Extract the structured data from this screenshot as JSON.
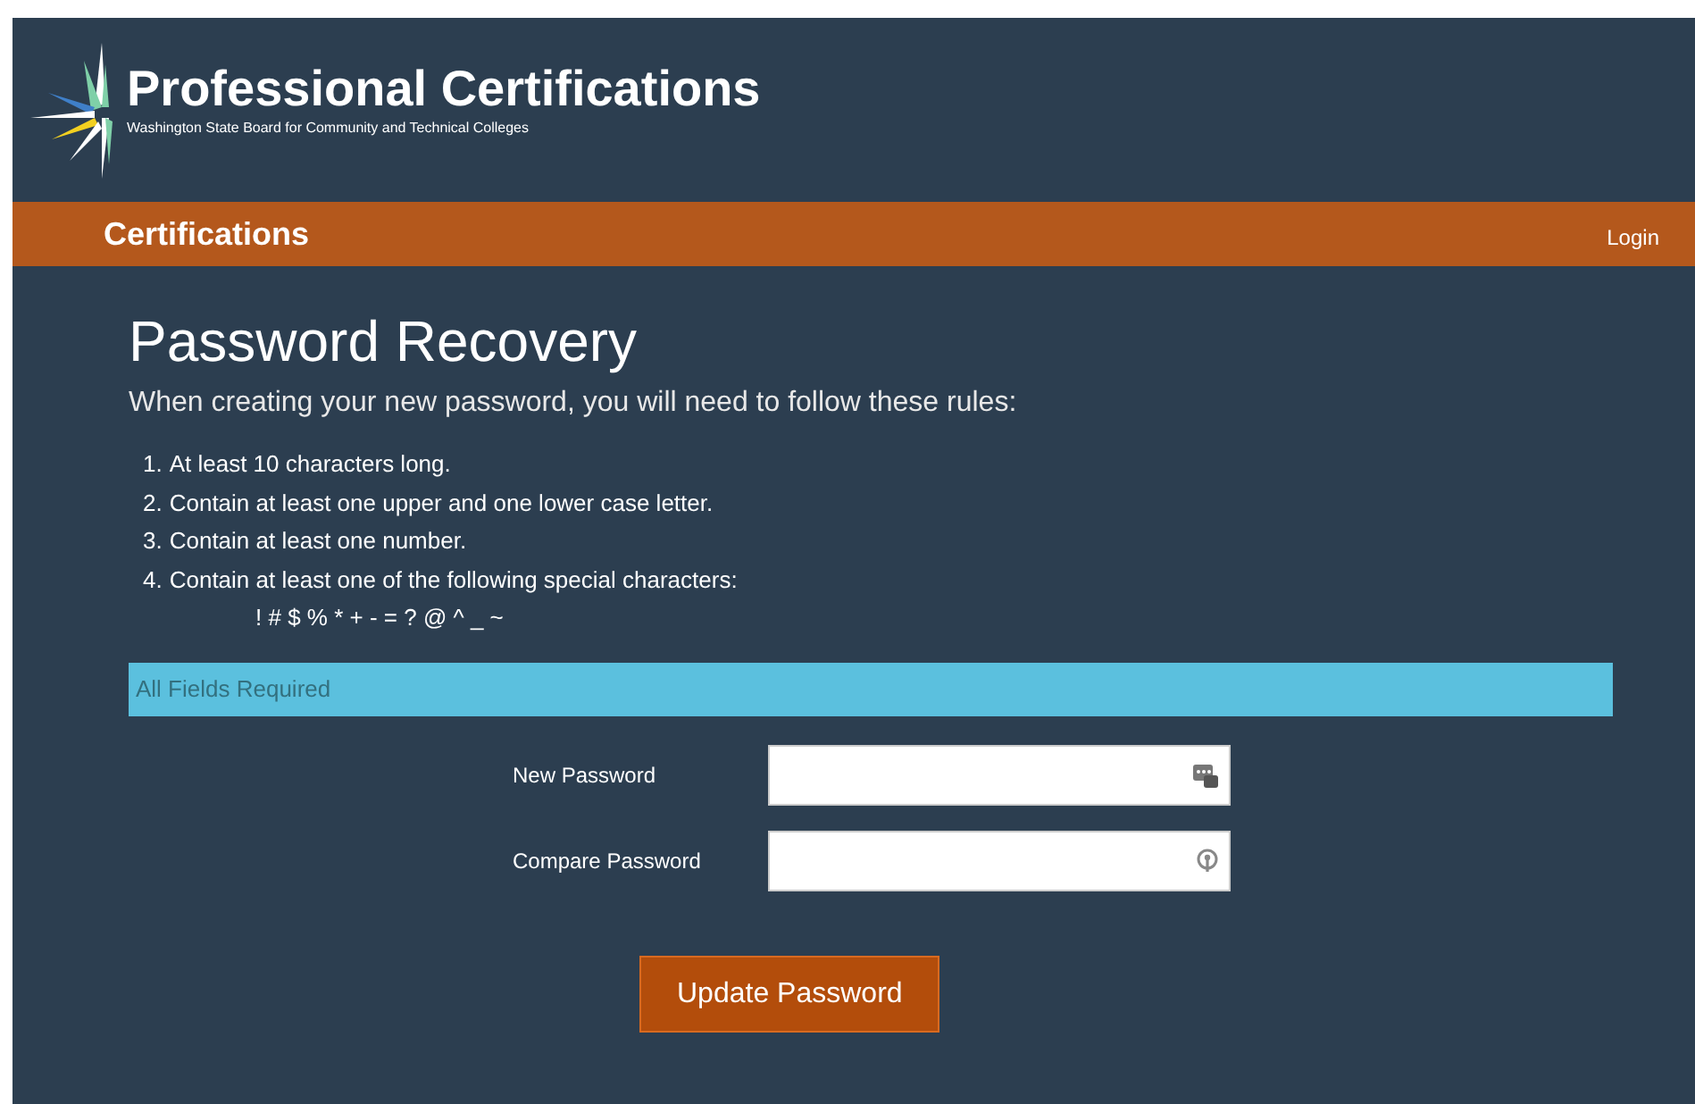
{
  "header": {
    "title": "Professional Certifications",
    "subtitle": "Washington State Board for Community and Technical Colleges"
  },
  "nav": {
    "brand": "Certifications",
    "links": [
      "Login"
    ]
  },
  "page": {
    "heading": "Password Recovery",
    "intro": "When creating your new password, you will need to follow these rules:",
    "rules": [
      {
        "number": "1.",
        "text": "At least 10 characters long."
      },
      {
        "number": "2.",
        "text": "Contain at least one upper and one lower case letter."
      },
      {
        "number": "3.",
        "text": "Contain at least one number."
      },
      {
        "number": "4.",
        "text": "Contain at least one of the following special characters:"
      }
    ],
    "special_characters": "! # $ % * + - = ? @ ^ _ ~",
    "notice": "All Fields Required",
    "fields": [
      {
        "label": "New Password"
      },
      {
        "label": "Compare Password"
      }
    ],
    "submit": "Update Password"
  }
}
